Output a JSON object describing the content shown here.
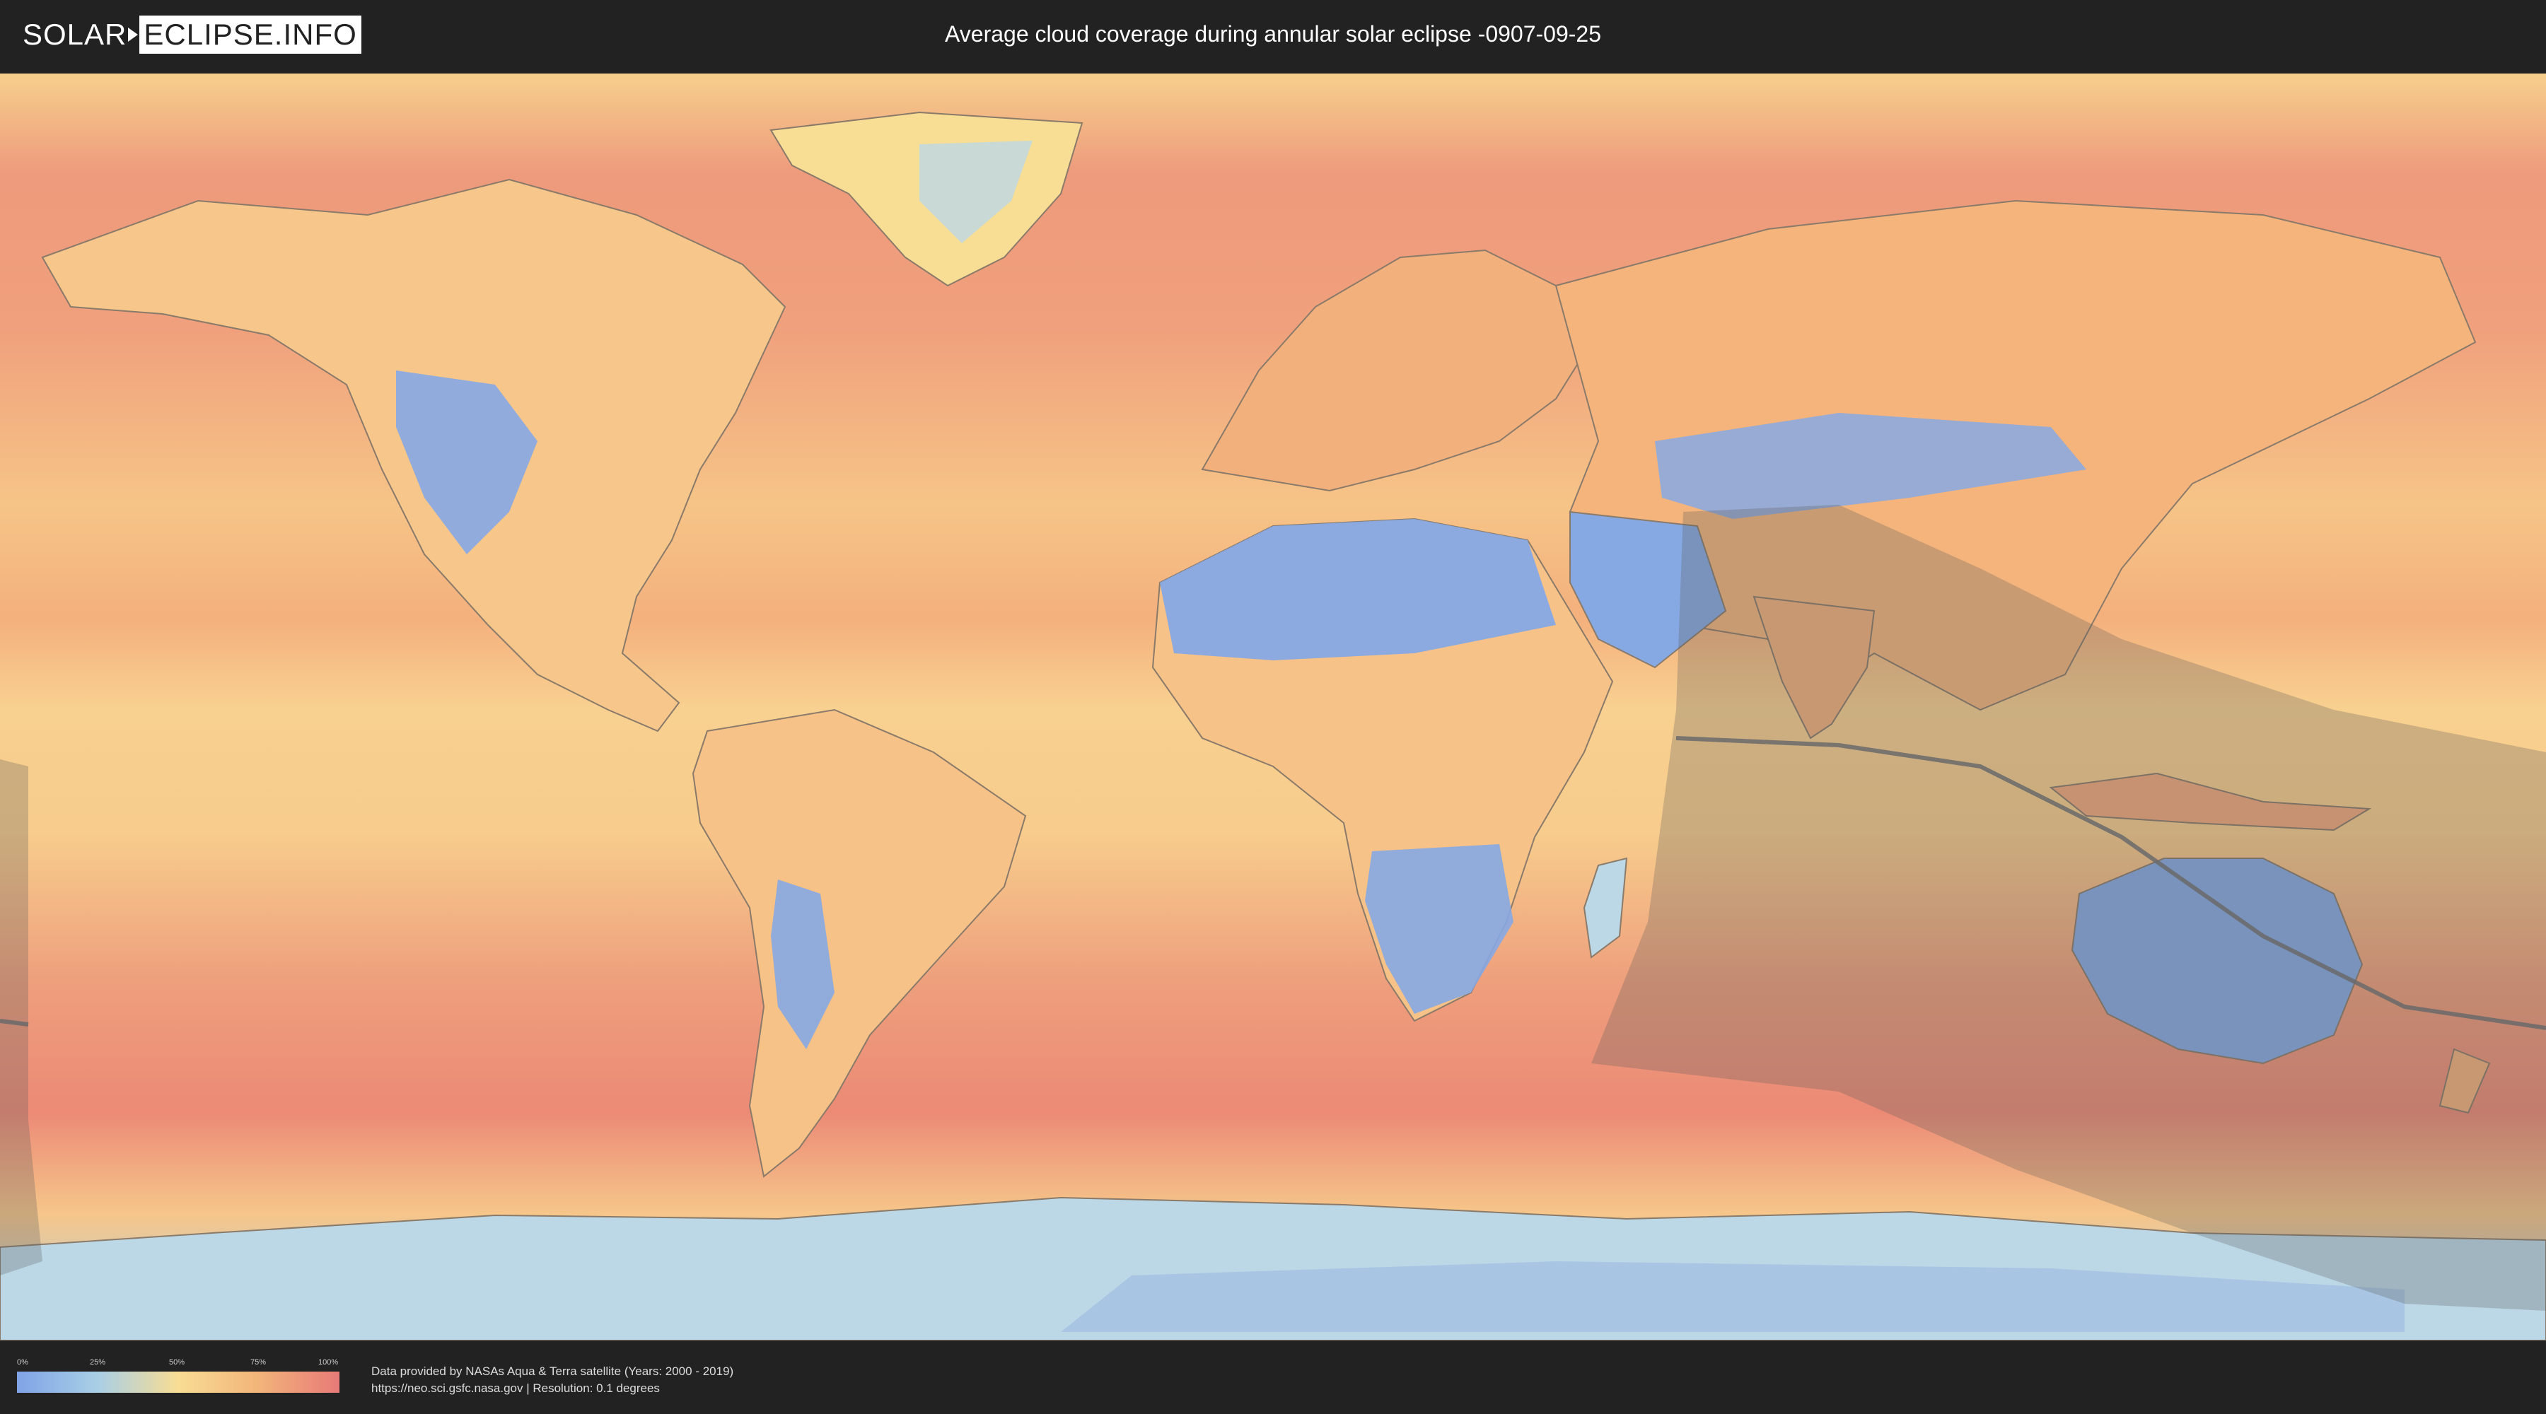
{
  "logo": {
    "left": "SOLAR",
    "right": "ECLIPSE.INFO"
  },
  "title": "Average cloud coverage during annular solar eclipse -0907-09-25",
  "legend": {
    "ticks": [
      "0%",
      "25%",
      "50%",
      "75%",
      "100%"
    ],
    "colors": [
      "#7fa3e6",
      "#a9cfe6",
      "#f8dd94",
      "#f2b47a",
      "#e87a78"
    ]
  },
  "credits": {
    "line1": "Data provided by NASAs Aqua & Terra satellite (Years: 2000 - 2019)",
    "line2": "https://neo.sci.gsfc.nasa.gov | Resolution: 0.1 degrees"
  },
  "map": {
    "colors": {
      "ocean_high": "#ec8a76",
      "ocean_mid": "#f4b27c",
      "ocean_low": "#f8d58e",
      "clear": "#86a9e4",
      "partial": "#bcd8e6",
      "eclipse_shade": "#5a5a5a",
      "border": "#7a6a5a"
    }
  }
}
